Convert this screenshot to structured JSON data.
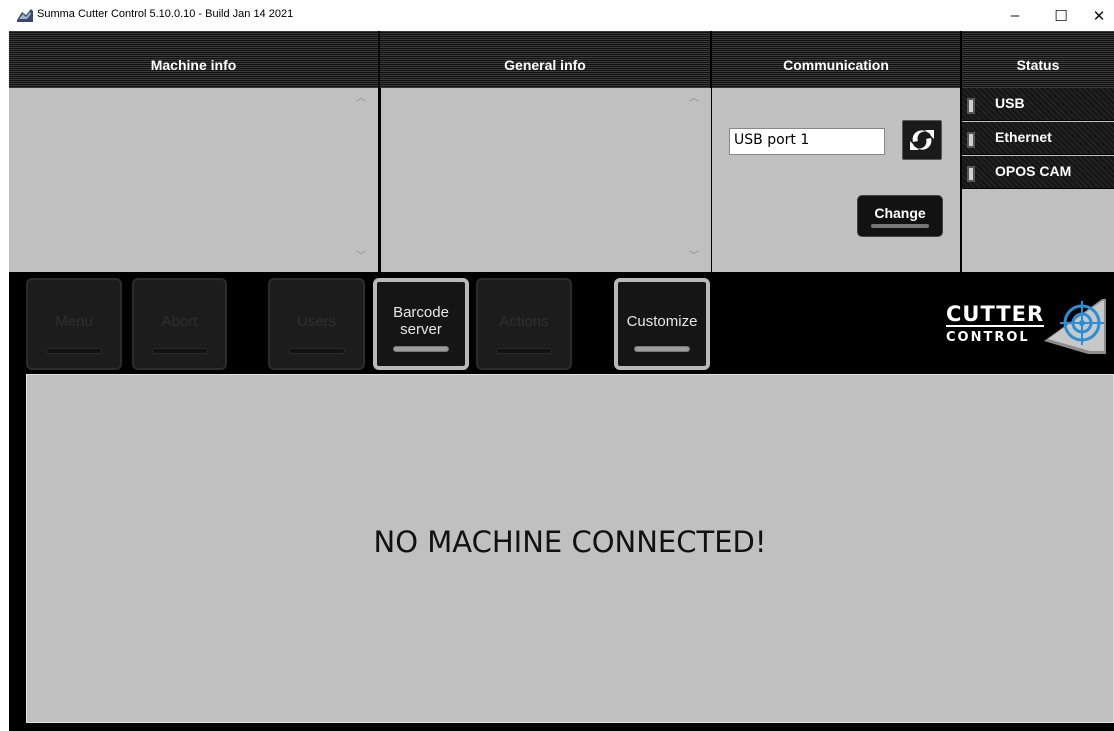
{
  "window": {
    "title": "Summa Cutter Control 5.10.0.10 - Build Jan 14 2021",
    "minimize": "–",
    "maximize": "☐",
    "close": "✕"
  },
  "headers": {
    "machine_info": "Machine info",
    "general_info": "General info",
    "communication": "Communication",
    "status": "Status"
  },
  "communication": {
    "port_value": "USB port 1",
    "change_label": "Change",
    "refresh_icon": "refresh-icon"
  },
  "status": {
    "items": [
      {
        "label": "USB"
      },
      {
        "label": "Ethernet"
      },
      {
        "label": "OPOS CAM"
      }
    ]
  },
  "toolbar": {
    "menu": "Menu",
    "abort": "Abort",
    "users": "Users",
    "barcode_line1": "Barcode",
    "barcode_line2": "server",
    "actions": "Actions",
    "customize": "Customize"
  },
  "logo": {
    "line1": "CUTTER",
    "line2": "CONTROL"
  },
  "main": {
    "message": "NO MACHINE CONNECTED!"
  },
  "colors": {
    "panel": "#c0c0c0",
    "frame": "#000000",
    "logo_accent": "#2a8fd6"
  }
}
